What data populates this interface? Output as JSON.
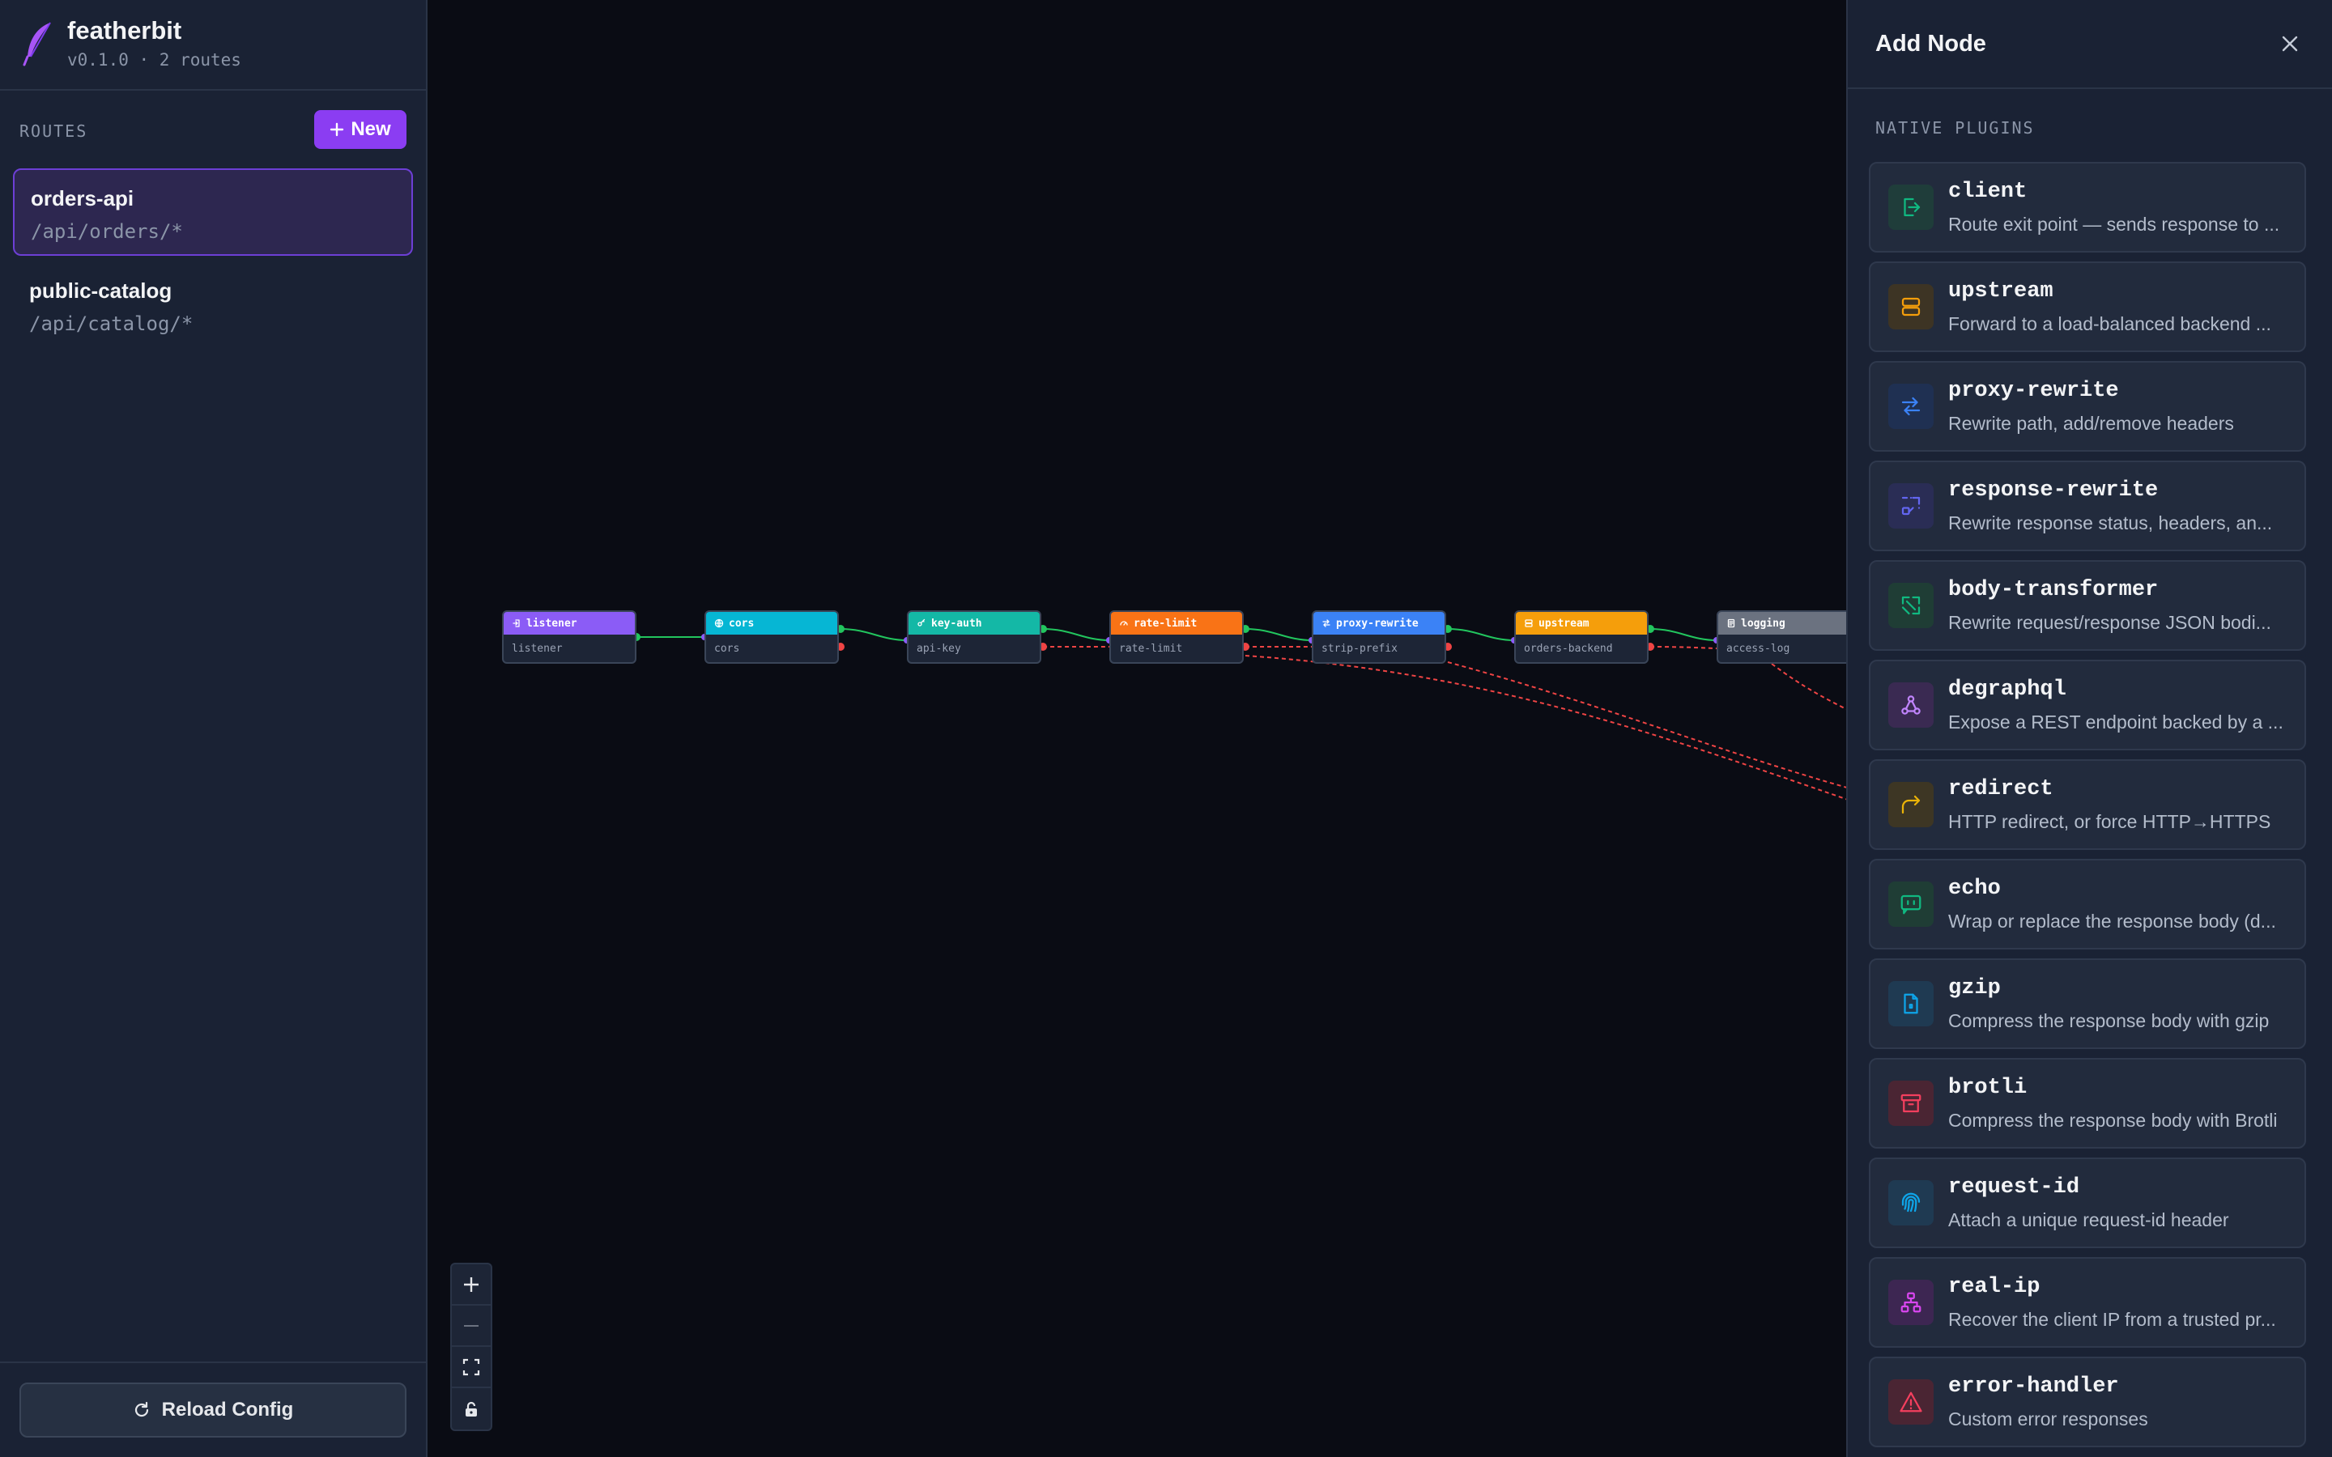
{
  "app": {
    "name": "featherbit",
    "meta": "v0.1.0 · 2 routes"
  },
  "sidebar": {
    "section_label": "ROUTES",
    "new_button": "New",
    "routes": [
      {
        "name": "orders-api",
        "path": "/api/orders/*",
        "active": true
      },
      {
        "name": "public-catalog",
        "path": "/api/catalog/*",
        "active": false
      }
    ],
    "reload_button": "Reload Config"
  },
  "canvas": {
    "nodes": [
      {
        "type": "listener",
        "label": "listener",
        "color": "#8b5cf6",
        "icon": "login-icon"
      },
      {
        "type": "cors",
        "label": "cors",
        "color": "#06b6d4",
        "icon": "globe-icon"
      },
      {
        "type": "key-auth",
        "label": "api-key",
        "color": "#14b8a6",
        "icon": "key-icon"
      },
      {
        "type": "rate-limit",
        "label": "rate-limit",
        "color": "#f97316",
        "icon": "gauge-icon"
      },
      {
        "type": "proxy-rewrite",
        "label": "strip-prefix",
        "color": "#3b82f6",
        "icon": "swap-icon"
      },
      {
        "type": "upstream",
        "label": "orders-backend",
        "color": "#f59e0b",
        "icon": "server-icon"
      },
      {
        "type": "logging",
        "label": "access-log",
        "color": "#6b7280",
        "icon": "log-icon"
      }
    ],
    "controls": [
      "zoom-in",
      "zoom-out",
      "fit-view",
      "lock"
    ]
  },
  "panel": {
    "title": "Add Node",
    "section_label": "NATIVE PLUGINS",
    "plugins": [
      {
        "name": "client",
        "desc": "Route exit point — sends response to ...",
        "color": "#10b981",
        "bg": "#1f3d3a",
        "icon": "exit-icon"
      },
      {
        "name": "upstream",
        "desc": "Forward to a load-balanced backend ...",
        "color": "#f59e0b",
        "bg": "#3d3424",
        "icon": "server-icon"
      },
      {
        "name": "proxy-rewrite",
        "desc": "Rewrite path, add/remove headers",
        "color": "#3b82f6",
        "bg": "#1f3052",
        "icon": "swap-icon"
      },
      {
        "name": "response-rewrite",
        "desc": "Rewrite response status, headers, an...",
        "color": "#6366f1",
        "bg": "#2a2d55",
        "icon": "rewrite-icon"
      },
      {
        "name": "body-transformer",
        "desc": "Rewrite request/response JSON bodi...",
        "color": "#10b981",
        "bg": "#1f3d35",
        "icon": "transform-icon"
      },
      {
        "name": "degraphql",
        "desc": "Expose a REST endpoint backed by a ...",
        "color": "#c084fc",
        "bg": "#3a2a52",
        "icon": "graph-icon"
      },
      {
        "name": "redirect",
        "desc": "HTTP redirect, or force HTTP→HTTPS",
        "color": "#eab308",
        "bg": "#3d3624",
        "icon": "redirect-icon"
      },
      {
        "name": "echo",
        "desc": "Wrap or replace the response body (d...",
        "color": "#10b981",
        "bg": "#1f3d35",
        "icon": "message-icon"
      },
      {
        "name": "gzip",
        "desc": "Compress the response body with gzip",
        "color": "#0ea5e9",
        "bg": "#1f3a52",
        "icon": "file-zip-icon"
      },
      {
        "name": "brotli",
        "desc": "Compress the response body with Brotli",
        "color": "#f43f5e",
        "bg": "#4a2533",
        "icon": "archive-icon"
      },
      {
        "name": "request-id",
        "desc": "Attach a unique request-id header",
        "color": "#0ea5e9",
        "bg": "#1f3a52",
        "icon": "fingerprint-icon"
      },
      {
        "name": "real-ip",
        "desc": "Recover the client IP from a trusted pr...",
        "color": "#d946ef",
        "bg": "#3d2652",
        "icon": "network-icon"
      },
      {
        "name": "error-handler",
        "desc": "Custom error responses",
        "color": "#f43f5e",
        "bg": "#4a2533",
        "icon": "warning-icon"
      }
    ]
  }
}
